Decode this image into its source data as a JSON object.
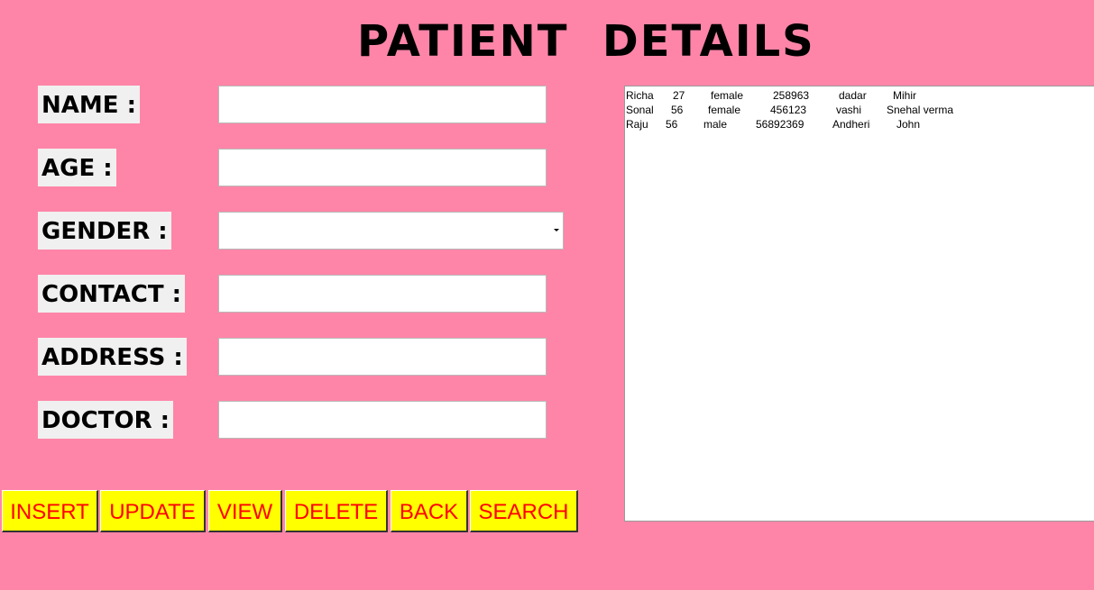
{
  "title": "PATIENT  DETAILS",
  "form": {
    "name_label": "NAME :",
    "name_value": "",
    "age_label": "AGE :",
    "age_value": "",
    "gender_label": "GENDER :",
    "gender_value": "",
    "contact_label": "CONTACT :",
    "contact_value": "",
    "address_label": "ADDRESS :",
    "address_value": "",
    "doctor_label": "DOCTOR :",
    "doctor_value": ""
  },
  "buttons": {
    "insert": "INSERT",
    "update": "UPDATE",
    "view": "VIEW",
    "delete": "DELETE",
    "back": "BACK",
    "search": "SEARCH"
  },
  "records": [
    [
      "Richa",
      "27",
      "female",
      "258963",
      "dadar",
      "Mihir"
    ],
    [
      "Sonal",
      "56",
      "female",
      "456123",
      "vashi",
      "Snehal verma"
    ],
    [
      "Raju",
      "56",
      "male",
      "56892369",
      "Andheri",
      "John"
    ]
  ],
  "colors": {
    "background": "#ff85a8",
    "button_bg": "#ffff00",
    "button_text": "#ff0000"
  },
  "icons": {
    "dropdown": "chevron-down-icon"
  }
}
